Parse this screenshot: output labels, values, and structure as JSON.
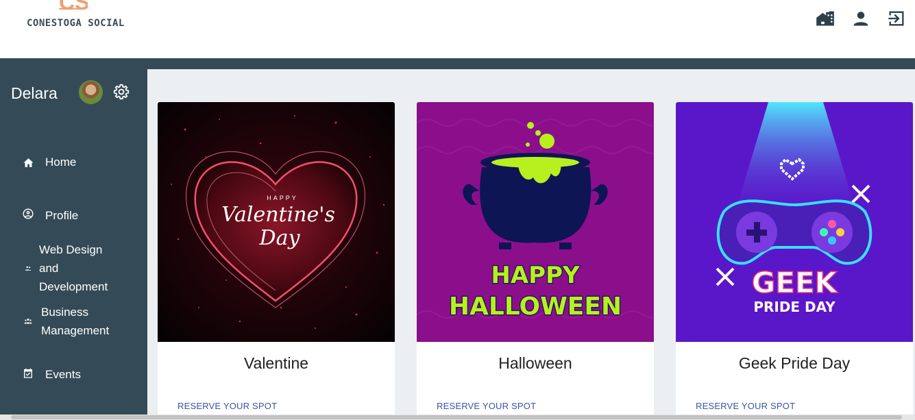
{
  "brand": {
    "mark": "CS",
    "name": "CONESTOGA SOCIAL"
  },
  "header_icons": [
    "home-work-icon",
    "person-icon",
    "logout-icon"
  ],
  "user": {
    "name": "Delara"
  },
  "sidebar": {
    "items": [
      {
        "label": "Home",
        "icon": "home-icon"
      },
      {
        "label": "Profile",
        "icon": "account-circle-icon"
      },
      {
        "label": "Web Design and Development",
        "icon": "group-icon"
      },
      {
        "label": "Business Management",
        "icon": "groups-icon"
      },
      {
        "label": "Events",
        "icon": "event-icon"
      }
    ]
  },
  "events": [
    {
      "title": "Valentine",
      "action": "RESERVE YOUR SPOT",
      "artwork": {
        "small": "HAPPY",
        "script1": "Valentine's",
        "script2": "Day"
      }
    },
    {
      "title": "Halloween",
      "action": "RESERVE YOUR SPOT",
      "artwork": {
        "line1": "HAPPY",
        "line2": "HALLOWEEN"
      }
    },
    {
      "title": "Geek Pride Day",
      "action": "RESERVE YOUR SPOT",
      "artwork": {
        "line1": "GEEK",
        "line2": "PRIDE DAY"
      }
    }
  ],
  "colors": {
    "sidebar": "#344b57",
    "content_bg": "#ebeff2",
    "link": "#3f51a5",
    "logo_accent": "#f0a070"
  }
}
